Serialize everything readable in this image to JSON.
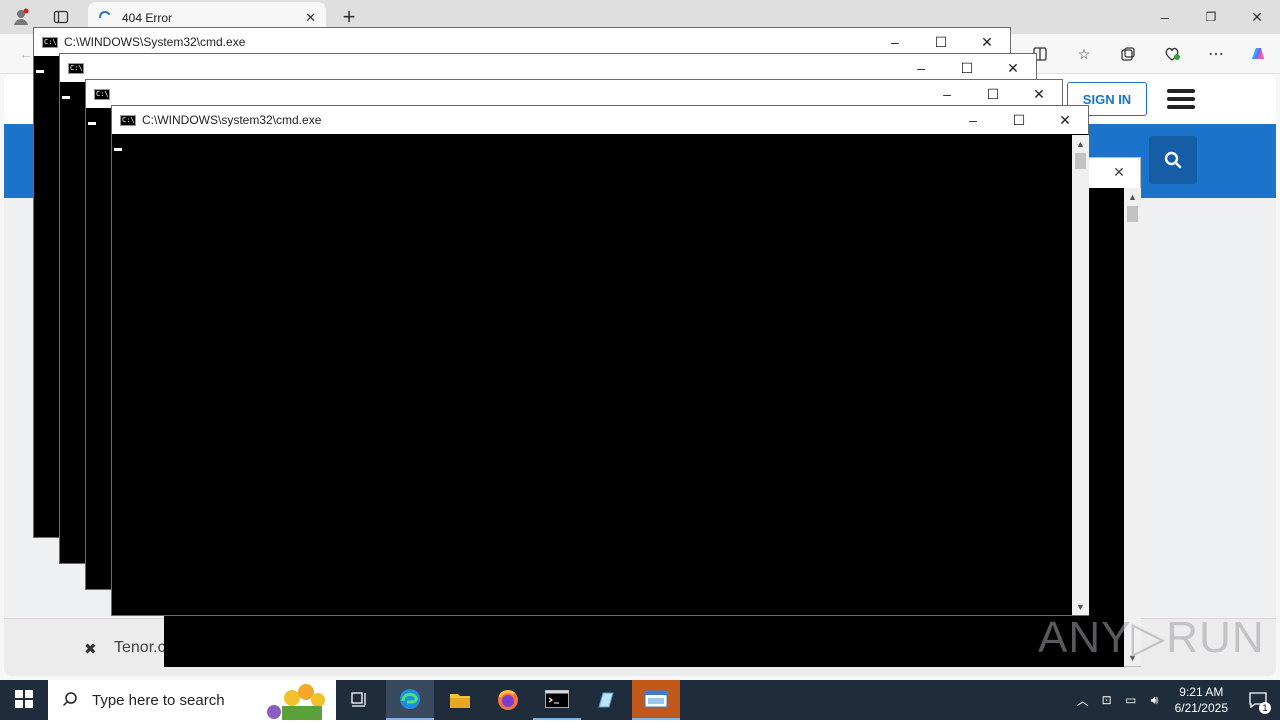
{
  "browser": {
    "tab_title": "404 Error",
    "new_tab_symbol": "+",
    "window_controls": {
      "minimize": "–",
      "restore": "❐",
      "close": "✕"
    }
  },
  "website": {
    "signin_label": "SIGN IN",
    "cookie_text": "Tenor.c"
  },
  "consoles": [
    {
      "title": "C:\\WINDOWS\\System32\\cmd.exe"
    },
    {
      "title": ""
    },
    {
      "title": ""
    },
    {
      "title": "C:\\WINDOWS\\system32\\cmd.exe"
    }
  ],
  "cmd_icon_text": "C:\\.",
  "watermark": "ANY▷RUN",
  "taskbar": {
    "search_placeholder": "Type here to search",
    "time": "9:21 AM",
    "date": "6/21/2025",
    "notification_count": "1"
  },
  "colors": {
    "accent_blue": "#1b74c9",
    "taskbar_bg": "#1f2c3b"
  }
}
